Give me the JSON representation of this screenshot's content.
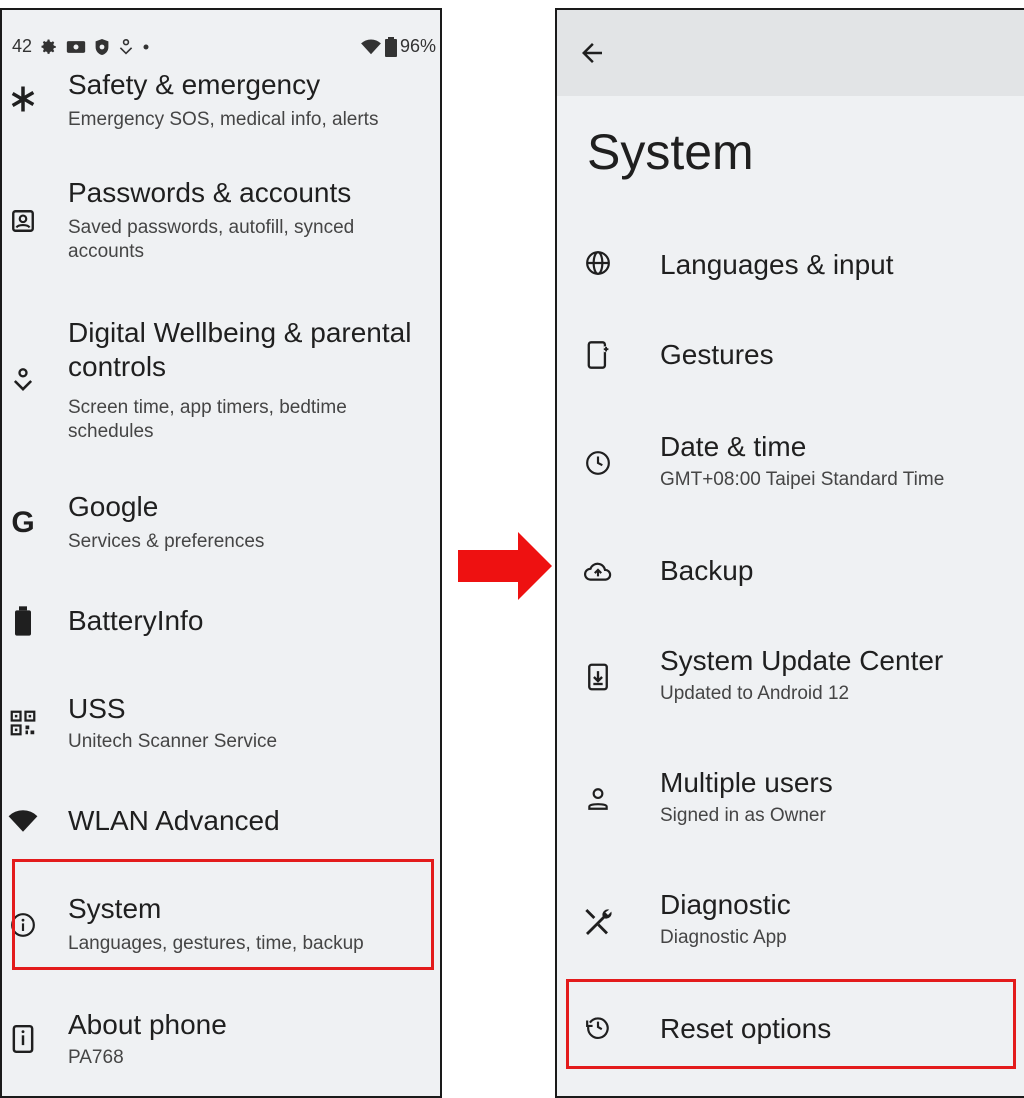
{
  "left": {
    "status": {
      "time": "42",
      "battery": "96%"
    },
    "items": [
      {
        "title": "Safety & emergency",
        "subtitle": "Emergency SOS, medical info, alerts",
        "icon": "asterisk-icon"
      },
      {
        "title": "Passwords & accounts",
        "subtitle": "Saved passwords, autofill, synced accounts",
        "icon": "account-box-icon"
      },
      {
        "title": "Digital Wellbeing & parental controls",
        "subtitle": "Screen time, app timers, bedtime schedules",
        "icon": "wellbeing-icon"
      },
      {
        "title": "Google",
        "subtitle": "Services & preferences",
        "icon": "google-icon"
      },
      {
        "title": "BatteryInfo",
        "subtitle": "",
        "icon": "battery-icon"
      },
      {
        "title": "USS",
        "subtitle": "Unitech Scanner Service",
        "icon": "qr-code-icon"
      },
      {
        "title": "WLAN Advanced",
        "subtitle": "",
        "icon": "wifi-icon"
      },
      {
        "title": "System",
        "subtitle": "Languages, gestures, time, backup",
        "icon": "info-icon"
      },
      {
        "title": "About phone",
        "subtitle": "PA768",
        "icon": "phone-info-icon"
      }
    ]
  },
  "right": {
    "page_title": "System",
    "items": [
      {
        "title": "Languages & input",
        "subtitle": "",
        "icon": "globe-icon"
      },
      {
        "title": "Gestures",
        "subtitle": "",
        "icon": "gesture-phone-icon"
      },
      {
        "title": "Date & time",
        "subtitle": "GMT+08:00 Taipei Standard Time",
        "icon": "clock-icon"
      },
      {
        "title": "Backup",
        "subtitle": "",
        "icon": "cloud-upload-icon"
      },
      {
        "title": "System Update Center",
        "subtitle": "Updated to Android 12",
        "icon": "system-update-icon"
      },
      {
        "title": "Multiple users",
        "subtitle": "Signed in as Owner",
        "icon": "person-icon"
      },
      {
        "title": "Diagnostic",
        "subtitle": "Diagnostic App",
        "icon": "tools-icon"
      },
      {
        "title": "Reset options",
        "subtitle": "",
        "icon": "history-icon"
      }
    ]
  },
  "colors": {
    "highlight": "#e31b1b",
    "arrow": "#ee1111",
    "background": "#eff1f3",
    "appbar": "#e2e4e6"
  }
}
